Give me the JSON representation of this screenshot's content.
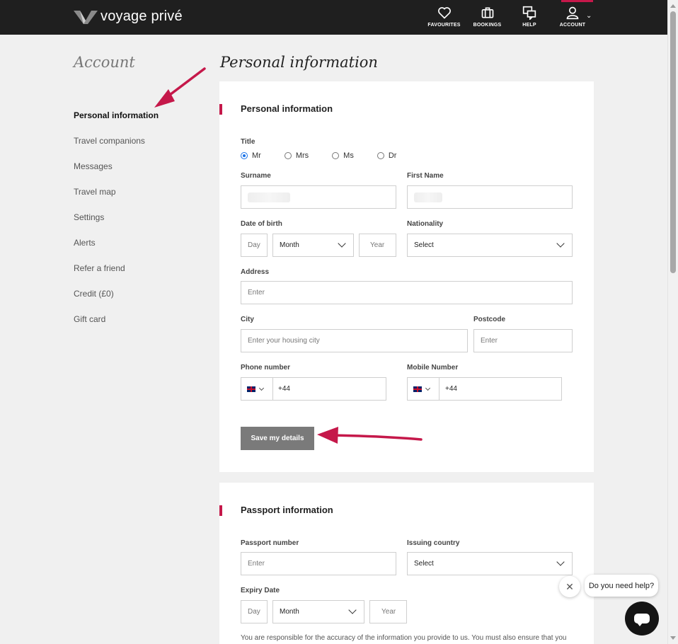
{
  "brand": {
    "name": "voyage privé"
  },
  "nav": {
    "favourites": "FAVOURITES",
    "bookings": "BOOKINGS",
    "help": "HELP",
    "account": "ACCOUNT"
  },
  "sidebar": {
    "title": "Account",
    "items": [
      {
        "label": "Personal information",
        "active": true
      },
      {
        "label": "Travel companions"
      },
      {
        "label": "Messages"
      },
      {
        "label": "Travel map"
      },
      {
        "label": "Settings"
      },
      {
        "label": "Alerts"
      },
      {
        "label": "Refer a friend"
      },
      {
        "label": "Credit (£0)"
      },
      {
        "label": "Gift card"
      }
    ]
  },
  "main": {
    "title": "Personal information",
    "personal": {
      "section_title": "Personal information",
      "title_label": "Title",
      "title_options": [
        "Mr",
        "Mrs",
        "Ms",
        "Dr"
      ],
      "title_selected": "Mr",
      "surname_label": "Surname",
      "first_name_label": "First Name",
      "dob_label": "Date of birth",
      "dob_day_placeholder": "Day",
      "dob_month_value": "Month",
      "dob_year_placeholder": "Year",
      "nationality_label": "Nationality",
      "nationality_value": "Select",
      "address_label": "Address",
      "address_placeholder": "Enter",
      "city_label": "City",
      "city_placeholder": "Enter your housing city",
      "postcode_label": "Postcode",
      "postcode_placeholder": "Enter",
      "phone_label": "Phone number",
      "phone_prefix": "+44",
      "mobile_label": "Mobile Number",
      "mobile_prefix": "+44",
      "save_label": "Save my details"
    },
    "passport": {
      "section_title": "Passport information",
      "number_label": "Passport number",
      "number_placeholder": "Enter",
      "country_label": "Issuing country",
      "country_value": "Select",
      "expiry_label": "Expiry Date",
      "expiry_day_placeholder": "Day",
      "expiry_month_value": "Month",
      "expiry_year_placeholder": "Year",
      "disclaimer": "You are responsible for the accuracy of the information you provide to us. You must also ensure that you"
    }
  },
  "chat": {
    "prompt": "Do you need help?"
  },
  "colors": {
    "accent": "#c5184a",
    "header": "#1f1f1f"
  }
}
